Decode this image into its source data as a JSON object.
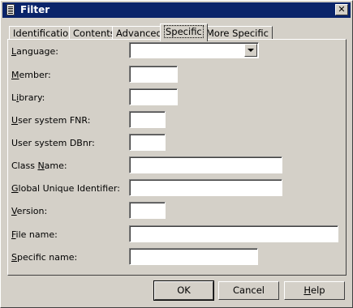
{
  "window": {
    "title": "Filter",
    "close_glyph": "✕"
  },
  "tabs": [
    {
      "label": "Identification",
      "active": false
    },
    {
      "label": "Contents",
      "active": false
    },
    {
      "label": "Advanced",
      "active": false
    },
    {
      "label": "Specific",
      "active": true
    },
    {
      "label": "More Specific",
      "active": false
    }
  ],
  "fields": {
    "language": {
      "label": "Language:",
      "mnemonic": "L",
      "value": ""
    },
    "member": {
      "label": "Member:",
      "mnemonic": "M",
      "value": ""
    },
    "library": {
      "label": "Library:",
      "mnemonic": "i",
      "value": ""
    },
    "user_system_fnr": {
      "label": "User system FNR:",
      "mnemonic": "U",
      "value": ""
    },
    "user_system_dbnr": {
      "label": "User system DBnr:",
      "mnemonic": "",
      "value": ""
    },
    "class_name": {
      "label": "Class Name:",
      "mnemonic": "N",
      "value": ""
    },
    "global_unique_identifier": {
      "label": "Global Unique Identifier:",
      "mnemonic": "G",
      "value": ""
    },
    "version": {
      "label": "Version:",
      "mnemonic": "V",
      "value": ""
    },
    "file_name": {
      "label": "File name:",
      "mnemonic": "F",
      "value": ""
    },
    "specific_name": {
      "label": "Specific name:",
      "mnemonic": "S",
      "value": ""
    }
  },
  "buttons": {
    "ok": "OK",
    "cancel": "Cancel",
    "help": "Help"
  },
  "icons": {
    "title": "document-icon",
    "close": "close-icon",
    "dropdown": "chevron-down-icon"
  },
  "colors": {
    "titlebar": "#0a246a",
    "face": "#d4d0c8"
  }
}
